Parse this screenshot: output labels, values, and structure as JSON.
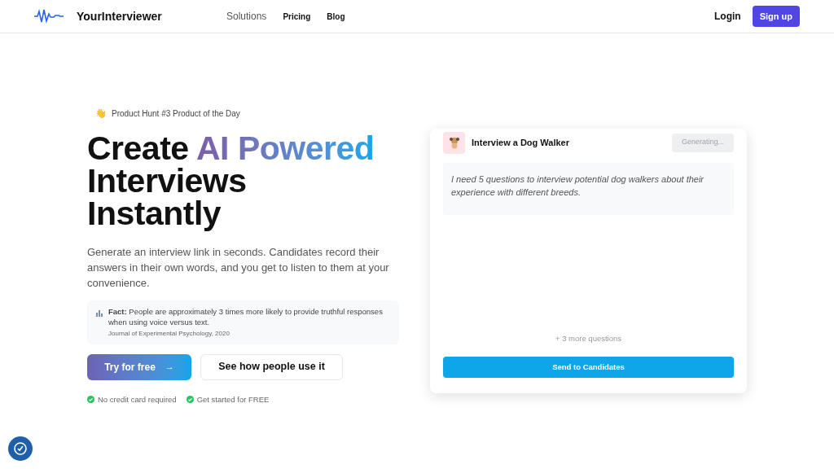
{
  "nav": {
    "brand": "YourInterviewer",
    "links": [
      {
        "label": "Solutions",
        "selected": true
      },
      {
        "label": "Pricing",
        "selected": false
      },
      {
        "label": "Blog",
        "selected": false
      }
    ],
    "login": "Login",
    "signup": "Sign up"
  },
  "hero": {
    "badge_emoji": "👋",
    "badge": "Product Hunt #3 Product of the Day",
    "title_start": "Create ",
    "title_highlight": "AI Powered",
    "title_rest": [
      "Interviews",
      "Instantly"
    ],
    "description": "Generate an interview link in seconds. Candidates record their answers in their own words, and you get to listen to them at your convenience.",
    "fact": {
      "text": "**Fact:** People are approximately 3 times more likely to provide truthful responses when using voice versus text.",
      "source": "Journal of Experimental Psychology, 2020"
    },
    "primary_button": "Try for free",
    "primary_arrow": "→",
    "secondary_button": "See how people use it",
    "perks": [
      "No credit card required",
      "Get started for FREE"
    ]
  },
  "demo": {
    "title": "Interview a Dog Walker",
    "generate_button": {
      "label": "Generating...",
      "disabled": true
    },
    "prompt": "I need 5 questions to interview potential dog walkers about their experience with different breeds.",
    "more": "+ 3 more questions",
    "send_button": "Send to Candidates"
  }
}
